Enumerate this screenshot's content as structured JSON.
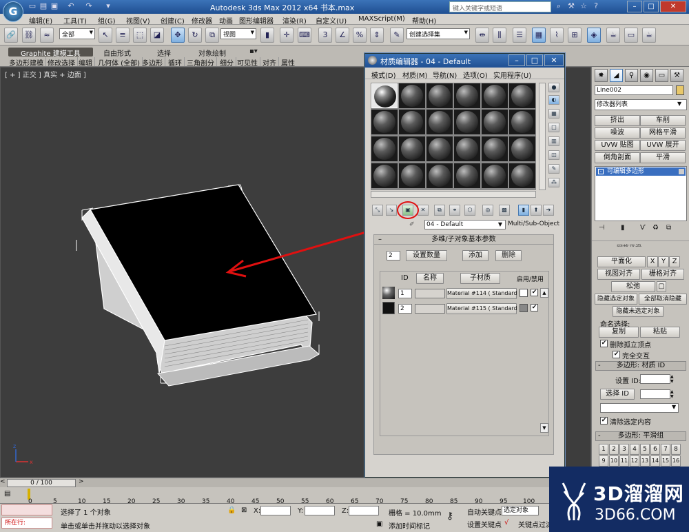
{
  "app": {
    "title": "Autodesk 3ds Max  2012 x64     书本.max",
    "search_placeholder": "键入关键字或短语",
    "logo_letter": "G"
  },
  "menubar": [
    "编辑(E)",
    "工具(T)",
    "组(G)",
    "视图(V)",
    "创建(C)",
    "修改器",
    "动画",
    "图形编辑器",
    "渲染(R)",
    "自定义(U)",
    "MAXScript(M)",
    "帮助(H)"
  ],
  "toolbar": {
    "selection_filter": "全部",
    "ref_coord": "视图",
    "named_selection": "创建选择集"
  },
  "ribbon": {
    "tabs": [
      "Graphite 建模工具",
      "自由形式",
      "选择",
      "对象绘制"
    ],
    "subtabs": [
      "多边形建模",
      "修改选择",
      "编辑",
      "几何体 (全部)",
      "多边形",
      "循环",
      "三角剖分",
      "细分",
      "可见性",
      "对齐",
      "属性"
    ]
  },
  "viewport": {
    "label": "[ + ] 正交 ] 真实 + 边面 ]"
  },
  "material_editor": {
    "title": "材质编辑器 - 04 - Default",
    "menu": [
      "模式(D)",
      "材质(M)",
      "导航(N)",
      "选项(O)",
      "实用程序(U)"
    ],
    "material_name": "04 - Default",
    "material_type": "Multi/Sub-Object",
    "rollout_title": "多维/子对象基本参数",
    "count": "2",
    "set_count_label": "设置数量",
    "add_label": "添加",
    "delete_label": "删除",
    "col_id": "ID",
    "col_name": "名称",
    "col_submat": "子材质",
    "col_onoff": "启用/禁用",
    "rows": [
      {
        "id": "1",
        "submat": "Material #114  ( Standard )"
      },
      {
        "id": "2",
        "submat": "Material #115  ( Standard )"
      }
    ]
  },
  "command_panel": {
    "object_name": "Line002",
    "modifier_list": "修改器列表",
    "modifier_buttons": [
      "挤出",
      "车削",
      "噪波",
      "网格平滑",
      "UVW 贴图",
      "UVW 展开",
      "倒角剖面",
      "平滑"
    ],
    "stack_item": "可编辑多边形",
    "partial_row": "网格平滑",
    "planarize_label": "平面化",
    "x_label": "X",
    "y_label": "Y",
    "z_label": "Z",
    "view_align_label": "视图对齐",
    "grid_align_label": "栅格对齐",
    "relax_label": "松弛",
    "hide_selected_label": "隐藏选定对象",
    "unhide_all_label": "全部取消隐藏",
    "hide_unselected_label": "隐藏未选定对象",
    "named_sel_label": "命名选择:",
    "copy_label": "复制",
    "paste_label": "粘贴",
    "delete_isolated_label": "删除孤立顶点",
    "full_interactive_label": "完全交互",
    "mat_id_section": "多边形: 材质 ID",
    "set_id_label": "设置 ID:",
    "select_id_label": "选择 ID",
    "clear_sel_label": "清除选定内容",
    "smooth_group_section": "多边形: 平滑组",
    "smooth_groups": [
      "1",
      "2",
      "3",
      "4",
      "5",
      "6",
      "7",
      "8",
      "9",
      "10",
      "11",
      "12",
      "13",
      "14",
      "15",
      "16"
    ]
  },
  "timeline": {
    "frame": "0 / 100",
    "ticks": [
      "0",
      "5",
      "10",
      "15",
      "20",
      "25",
      "30",
      "35",
      "40",
      "45",
      "50",
      "55",
      "60",
      "65",
      "70",
      "75",
      "80",
      "85",
      "90",
      "95",
      "100"
    ]
  },
  "status": {
    "selected": "选择了 1 个对象",
    "prompt": "单击或单击并拖动以选择对象",
    "running": "所在行:",
    "x_label": "X:",
    "y_label": "Y:",
    "z_label": "Z:",
    "grid": "栅格 = 10.0mm",
    "add_time_tag": "添加时间标记",
    "auto_key": "自动关键点",
    "set_key": "设置关键点",
    "selected_obj": "选定对象",
    "key_filters": "关键点过滤"
  },
  "watermark": {
    "brand": "3D溜溜网",
    "url": "3D66.COM"
  },
  "colors": {
    "title_blue": "#1f4f92",
    "viewport_bg": "#3d3d3d",
    "panel_gray": "#d6d3ce",
    "annotation_red": "#e01010",
    "watermark_bg": "#132c63"
  }
}
